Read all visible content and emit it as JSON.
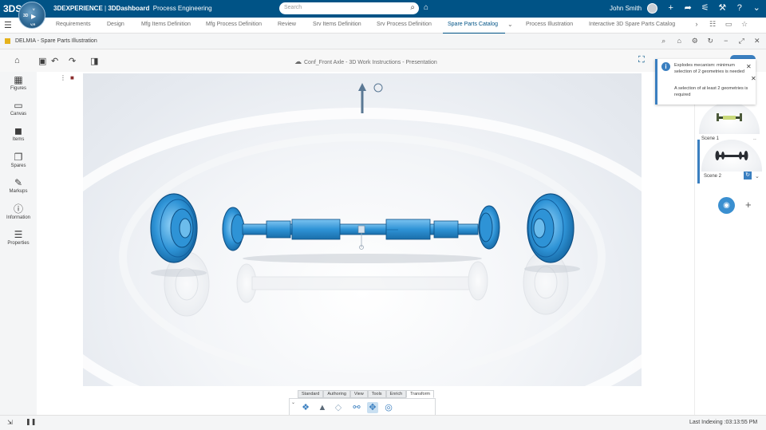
{
  "header": {
    "ds_logo": "3DS",
    "compass": {
      "label_3d": "3D",
      "label_v": "V",
      "label_va": "V,R",
      "play_icon": "play-icon"
    },
    "brand_product": "3DEXPERIENCE",
    "brand_separator": " | ",
    "brand_app": "3DDashboard",
    "brand_context": "Process Engineering",
    "search_placeholder": "Search",
    "user_name": "John Smith",
    "icons": [
      "plus-icon",
      "share-icon",
      "broadcast-icon",
      "tools-icon",
      "help-icon",
      "chevron-down-icon"
    ]
  },
  "tabs": {
    "items": [
      {
        "label": "Requirements"
      },
      {
        "label": "Design"
      },
      {
        "label": "Mfg Items Definition"
      },
      {
        "label": "Mfg Process Definition"
      },
      {
        "label": "Review"
      },
      {
        "label": "Srv Items Definition"
      },
      {
        "label": "Srv Process Definition"
      },
      {
        "label": "Spare Parts Catalog"
      },
      {
        "label": "Process Illustration"
      },
      {
        "label": "Interactive 3D Spare Parts Catalog"
      }
    ],
    "active_index": 7
  },
  "app": {
    "title": "DELMIA - Spare Parts Illustration",
    "icons": [
      "search-icon",
      "home-outline-icon",
      "gear-icon",
      "refresh-icon",
      "minimize-icon",
      "maximize-icon",
      "close-icon"
    ]
  },
  "action_bar": {
    "document_title": "Conf_Front Axle - 3D Work Instructions - Presentation"
  },
  "sidebar": {
    "items": [
      {
        "label": "Figures",
        "icon": "figures-icon"
      },
      {
        "label": "Canvas",
        "icon": "canvas-icon"
      },
      {
        "label": "Items",
        "icon": "items-icon"
      },
      {
        "label": "Spares",
        "icon": "spares-icon"
      },
      {
        "label": "Markups",
        "icon": "markups-icon"
      },
      {
        "label": "Information",
        "icon": "information-icon"
      },
      {
        "label": "Properties",
        "icon": "properties-icon"
      }
    ]
  },
  "notification": {
    "message": "Explodes mecanism: minimum selection of 2 geometries is needed",
    "detail": "A selection of at least 2 geometries is required"
  },
  "scenes": {
    "items": [
      {
        "label": "Scene 1"
      },
      {
        "label": "Scene 2"
      }
    ],
    "selected_index": 1
  },
  "bottom_toolbar": {
    "tabs": [
      "Standard",
      "Authoring",
      "View",
      "Tools",
      "Enrich",
      "Transform"
    ],
    "active_tab": "Transform",
    "tools": [
      "explode-icon",
      "move-icon",
      "snap-icon",
      "align-icon",
      "robot-icon",
      "rotate-icon"
    ]
  },
  "status": {
    "last_indexing": "Last Indexing :03:13:55 PM"
  },
  "colors": {
    "header_bg": "#005386",
    "accent": "#3a7fc0",
    "part_blue": "#2e93d6"
  }
}
